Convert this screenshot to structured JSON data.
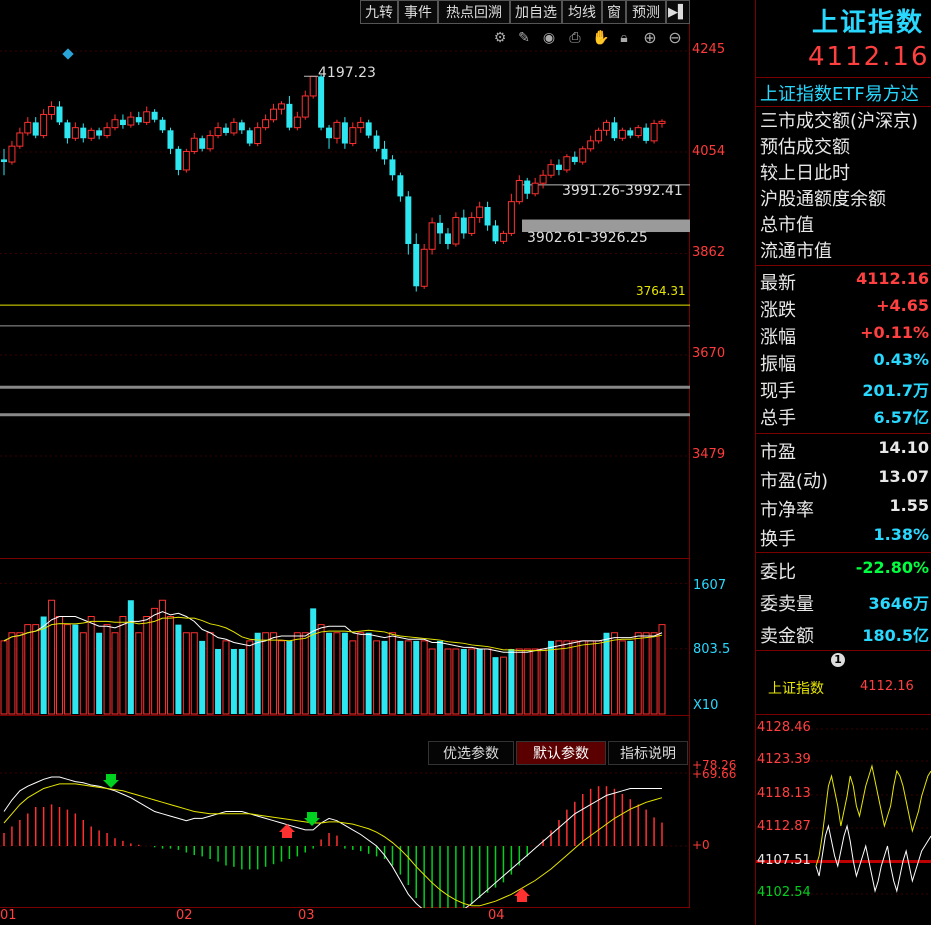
{
  "toolbar": {
    "buttons": [
      "九转",
      "事件",
      "热点回溯",
      "加自选",
      "均线",
      "窗",
      "预测"
    ]
  },
  "main_chart": {
    "axis_labels": [
      "4245",
      "4054",
      "3862",
      "3670",
      "3479"
    ],
    "high_label": "4197.23",
    "gap1_label": "3991.26-3992.41",
    "gap2_label": "3902.61-3926.25",
    "level_label": "3764.31",
    "candles": [
      [
        4040,
        4035,
        4060,
        4010
      ],
      [
        4035,
        4065,
        4075,
        4030
      ],
      [
        4065,
        4090,
        4100,
        4060
      ],
      [
        4090,
        4110,
        4120,
        4085
      ],
      [
        4110,
        4085,
        4120,
        4080
      ],
      [
        4085,
        4125,
        4135,
        4080
      ],
      [
        4125,
        4140,
        4150,
        4115
      ],
      [
        4140,
        4110,
        4150,
        4105
      ],
      [
        4110,
        4080,
        4115,
        4070
      ],
      [
        4080,
        4100,
        4110,
        4075
      ],
      [
        4100,
        4080,
        4108,
        4072
      ],
      [
        4080,
        4095,
        4100,
        4075
      ],
      [
        4095,
        4085,
        4100,
        4078
      ],
      [
        4085,
        4100,
        4110,
        4080
      ],
      [
        4100,
        4115,
        4125,
        4095
      ],
      [
        4115,
        4105,
        4125,
        4098
      ],
      [
        4105,
        4120,
        4130,
        4100
      ],
      [
        4120,
        4110,
        4130,
        4105
      ],
      [
        4110,
        4130,
        4140,
        4105
      ],
      [
        4130,
        4115,
        4135,
        4110
      ],
      [
        4115,
        4095,
        4120,
        4090
      ],
      [
        4095,
        4060,
        4100,
        4050
      ],
      [
        4060,
        4020,
        4065,
        4010
      ],
      [
        4020,
        4055,
        4060,
        4015
      ],
      [
        4055,
        4080,
        4090,
        4050
      ],
      [
        4080,
        4060,
        4085,
        4055
      ],
      [
        4060,
        4085,
        4095,
        4055
      ],
      [
        4085,
        4100,
        4110,
        4080
      ],
      [
        4100,
        4090,
        4108,
        4085
      ],
      [
        4090,
        4110,
        4118,
        4085
      ],
      [
        4110,
        4095,
        4115,
        4088
      ],
      [
        4095,
        4070,
        4100,
        4065
      ],
      [
        4070,
        4100,
        4110,
        4065
      ],
      [
        4100,
        4115,
        4125,
        4095
      ],
      [
        4115,
        4135,
        4145,
        4110
      ],
      [
        4135,
        4145,
        4150,
        4125
      ],
      [
        4145,
        4100,
        4160,
        4095
      ],
      [
        4100,
        4120,
        4130,
        4095
      ],
      [
        4120,
        4160,
        4170,
        4115
      ],
      [
        4160,
        4197,
        4197,
        4155
      ],
      [
        4197,
        4100,
        4200,
        4095
      ],
      [
        4100,
        4080,
        4105,
        4060
      ],
      [
        4080,
        4110,
        4115,
        4070
      ],
      [
        4110,
        4070,
        4120,
        4060
      ],
      [
        4070,
        4100,
        4110,
        4065
      ],
      [
        4100,
        4110,
        4120,
        4090
      ],
      [
        4110,
        4085,
        4115,
        4080
      ],
      [
        4085,
        4060,
        4095,
        4055
      ],
      [
        4060,
        4040,
        4075,
        4030
      ],
      [
        4040,
        4010,
        4048,
        4000
      ],
      [
        4010,
        3970,
        4015,
        3960
      ],
      [
        3970,
        3880,
        3980,
        3860
      ],
      [
        3880,
        3800,
        3900,
        3790
      ],
      [
        3800,
        3870,
        3880,
        3795
      ],
      [
        3870,
        3920,
        3930,
        3860
      ],
      [
        3920,
        3900,
        3935,
        3880
      ],
      [
        3900,
        3880,
        3910,
        3870
      ],
      [
        3880,
        3930,
        3940,
        3875
      ],
      [
        3930,
        3900,
        3945,
        3890
      ],
      [
        3900,
        3930,
        3940,
        3895
      ],
      [
        3930,
        3950,
        3960,
        3920
      ],
      [
        3950,
        3915,
        3960,
        3905
      ],
      [
        3915,
        3885,
        3925,
        3880
      ],
      [
        3885,
        3900,
        3905,
        3880
      ],
      [
        3900,
        3960,
        3975,
        3895
      ],
      [
        3960,
        4000,
        4010,
        3955
      ],
      [
        4000,
        3975,
        4005,
        3965
      ],
      [
        3975,
        3995,
        4005,
        3970
      ],
      [
        3995,
        4010,
        4020,
        3985
      ],
      [
        4010,
        4030,
        4040,
        4005
      ],
      [
        4030,
        4020,
        4040,
        4010
      ],
      [
        4020,
        4045,
        4050,
        4015
      ],
      [
        4045,
        4035,
        4055,
        4030
      ],
      [
        4035,
        4060,
        4065,
        4030
      ],
      [
        4060,
        4075,
        4085,
        4055
      ],
      [
        4075,
        4095,
        4100,
        4070
      ],
      [
        4095,
        4110,
        4115,
        4085
      ],
      [
        4110,
        4080,
        4120,
        4075
      ],
      [
        4080,
        4095,
        4100,
        4075
      ],
      [
        4095,
        4085,
        4100,
        4080
      ],
      [
        4085,
        4100,
        4105,
        4080
      ],
      [
        4100,
        4075,
        4108,
        4070
      ],
      [
        4075,
        4108,
        4115,
        4070
      ],
      [
        4108,
        4112,
        4116,
        4100
      ]
    ]
  },
  "volume": {
    "axis_labels": [
      "1607",
      "803.5",
      "X10"
    ],
    "bars": [
      [
        9,
        1
      ],
      [
        10,
        1
      ],
      [
        10,
        1
      ],
      [
        11,
        1
      ],
      [
        11,
        1
      ],
      [
        12,
        0
      ],
      [
        14,
        1
      ],
      [
        12,
        1
      ],
      [
        11,
        1
      ],
      [
        11,
        0
      ],
      [
        10,
        1
      ],
      [
        12,
        1
      ],
      [
        10,
        0
      ],
      [
        11,
        1
      ],
      [
        10,
        1
      ],
      [
        12,
        1
      ],
      [
        14,
        0
      ],
      [
        10,
        1
      ],
      [
        12,
        1
      ],
      [
        13,
        1
      ],
      [
        14,
        1
      ],
      [
        12,
        1
      ],
      [
        11,
        0
      ],
      [
        10,
        1
      ],
      [
        10,
        1
      ],
      [
        9,
        0
      ],
      [
        10,
        1
      ],
      [
        8,
        0
      ],
      [
        9,
        1
      ],
      [
        8,
        0
      ],
      [
        8,
        0
      ],
      [
        9,
        1
      ],
      [
        10,
        0
      ],
      [
        10,
        1
      ],
      [
        10,
        1
      ],
      [
        9,
        1
      ],
      [
        9,
        0
      ],
      [
        10,
        1
      ],
      [
        10,
        1
      ],
      [
        13,
        0
      ],
      [
        11,
        1
      ],
      [
        10,
        0
      ],
      [
        10,
        1
      ],
      [
        10,
        0
      ],
      [
        9,
        1
      ],
      [
        10,
        1
      ],
      [
        10,
        0
      ],
      [
        9,
        1
      ],
      [
        9,
        0
      ],
      [
        10,
        1
      ],
      [
        9,
        0
      ],
      [
        9,
        1
      ],
      [
        9,
        0
      ],
      [
        9,
        1
      ],
      [
        8,
        1
      ],
      [
        9,
        0
      ],
      [
        8,
        1
      ],
      [
        8,
        1
      ],
      [
        8,
        0
      ],
      [
        8,
        1
      ],
      [
        8,
        0
      ],
      [
        8,
        1
      ],
      [
        7,
        0
      ],
      [
        7,
        1
      ],
      [
        8,
        0
      ],
      [
        8,
        1
      ],
      [
        8,
        1
      ],
      [
        8,
        1
      ],
      [
        8,
        1
      ],
      [
        9,
        0
      ],
      [
        9,
        1
      ],
      [
        9,
        1
      ],
      [
        9,
        1
      ],
      [
        9,
        1
      ],
      [
        9,
        1
      ],
      [
        9,
        1
      ],
      [
        10,
        0
      ],
      [
        10,
        1
      ],
      [
        9,
        1
      ],
      [
        9,
        0
      ],
      [
        10,
        1
      ],
      [
        10,
        1
      ],
      [
        10,
        1
      ],
      [
        11,
        1
      ]
    ]
  },
  "indicator": {
    "tabs": [
      "优选参数",
      "默认参数",
      "指标说明"
    ],
    "active_tab": 1,
    "axis_labels": [
      "+78.26",
      "+69.66",
      "+0"
    ],
    "hist": [
      10,
      15,
      20,
      25,
      30,
      30,
      32,
      30,
      28,
      25,
      20,
      15,
      12,
      10,
      6,
      4,
      2,
      1,
      0,
      -1,
      -2,
      -2,
      -3,
      -5,
      -7,
      -8,
      -10,
      -12,
      -15,
      -16,
      -18,
      -18,
      -18,
      -16,
      -14,
      -12,
      -10,
      -8,
      -5,
      -2,
      5,
      10,
      8,
      -2,
      -3,
      -4,
      -6,
      -8,
      -10,
      -15,
      -22,
      -30,
      -40,
      -48,
      -52,
      -55,
      -54,
      -50,
      -48,
      -45,
      -40,
      -36,
      -32,
      -28,
      -22,
      -15,
      -8,
      0,
      5,
      12,
      20,
      28,
      34,
      40,
      44,
      46,
      46,
      44,
      40,
      36,
      32,
      28,
      22,
      18
    ]
  },
  "dates": [
    "01",
    "02",
    "03",
    "04"
  ],
  "right_panel": {
    "title": "上证指数",
    "price": "4112.16",
    "related": "上证指数ETF易方达",
    "info_labels": [
      "三市成交额(沪深京)",
      "预估成交额",
      "较上日此时",
      "沪股通额度余额",
      "总市值",
      "流通市值"
    ],
    "quotes": [
      {
        "label": "最新",
        "value": "4112.16",
        "color": "red"
      },
      {
        "label": "涨跌",
        "value": "+4.65",
        "color": "red"
      },
      {
        "label": "涨幅",
        "value": "+0.11%",
        "color": "red"
      },
      {
        "label": "振幅",
        "value": "0.43%",
        "color": "cyan"
      },
      {
        "label": "现手",
        "value": "201.7万",
        "color": "cyan"
      },
      {
        "label": "总手",
        "value": "6.57亿",
        "color": "cyan"
      }
    ],
    "valuation": [
      {
        "label": "市盈",
        "value": "14.10",
        "color": "white"
      },
      {
        "label": "市盈(动)",
        "value": "13.07",
        "color": "white"
      },
      {
        "label": "市净率",
        "value": "1.55",
        "color": "white"
      },
      {
        "label": "换手",
        "value": "1.38%",
        "color": "cyan"
      }
    ],
    "order": [
      {
        "label": "委比",
        "value": "-22.80%",
        "color": "green"
      },
      {
        "label": "委卖量",
        "value": "3646万",
        "color": "cyan"
      },
      {
        "label": "卖金额",
        "value": "180.5亿",
        "color": "cyan"
      }
    ],
    "badge": "1",
    "mini_name": "上证指数",
    "mini_price": "4112.16",
    "mini_axis": [
      "4128.46",
      "4123.39",
      "4118.13",
      "4112.87",
      "4107.51",
      "4102.54"
    ]
  }
}
